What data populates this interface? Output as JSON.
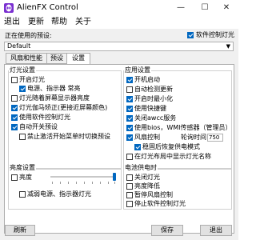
{
  "window": {
    "title": "AlienFX Control"
  },
  "menu": {
    "exit": "退出",
    "update": "更新",
    "help": "帮助",
    "about": "关于"
  },
  "titlebar_icons": {
    "minimize": "—",
    "maximize": "☐",
    "close": "✕"
  },
  "profile": {
    "label": "正在使用的预设:",
    "selected": "Default",
    "software_control": {
      "label": "软件控制灯光",
      "checked": true
    }
  },
  "tabs": [
    {
      "label": "风扇和性能",
      "active": false
    },
    {
      "label": "预设",
      "active": false
    },
    {
      "label": "设置",
      "active": true
    }
  ],
  "light_settings": {
    "title": "灯光设置",
    "items": [
      {
        "label": "开启灯光",
        "checked": false
      },
      {
        "label": "电源、指示器 常亮",
        "checked": true
      },
      {
        "label": "灯光随着屏幕显示器亮度",
        "checked": false
      },
      {
        "label": "灯光伽马矫正(更接近屏幕颜色)",
        "checked": true
      },
      {
        "label": "使用软件控制灯光",
        "checked": true
      },
      {
        "label": "自动开关预设",
        "checked": true
      },
      {
        "label": "禁止激活开始菜单时切换预设",
        "checked": false
      }
    ]
  },
  "app_settings": {
    "title": "应用设置",
    "items": [
      {
        "label": "开机启动",
        "checked": true
      },
      {
        "label": "自动检测更新",
        "checked": false
      },
      {
        "label": "开启时最小化",
        "checked": true
      },
      {
        "label": "使用快捷键",
        "checked": true
      },
      {
        "label": "关闭awcc服务",
        "checked": true
      },
      {
        "label": "使用bios，WMI传感器（管理员）",
        "checked": true
      },
      {
        "label": "风扇控制",
        "checked": true
      },
      {
        "label": "稳固后恢复供电模式",
        "checked": true
      },
      {
        "label": "在灯光布局中显示灯光名称",
        "checked": false
      }
    ],
    "polling": {
      "label": "轮询时间",
      "value": "750"
    }
  },
  "brightness": {
    "title": "亮度设置",
    "dim": {
      "label": "亮度",
      "checked": false,
      "level_percent": 100
    },
    "dim_power": {
      "label": "减弱电源、指示器灯光",
      "checked": false
    }
  },
  "battery": {
    "title": "电池供电时",
    "items": [
      {
        "label": "关闭灯光",
        "checked": false
      },
      {
        "label": "亮度降低",
        "checked": false
      },
      {
        "label": "暂停风扇控制",
        "checked": false
      },
      {
        "label": "停止软件控制灯光",
        "checked": false
      }
    ]
  },
  "buttons": {
    "refresh": "刷新",
    "save": "保存",
    "exit": "退出"
  },
  "colors": {
    "accent": "#0067c0",
    "window_bg": "#f0f0f0"
  }
}
